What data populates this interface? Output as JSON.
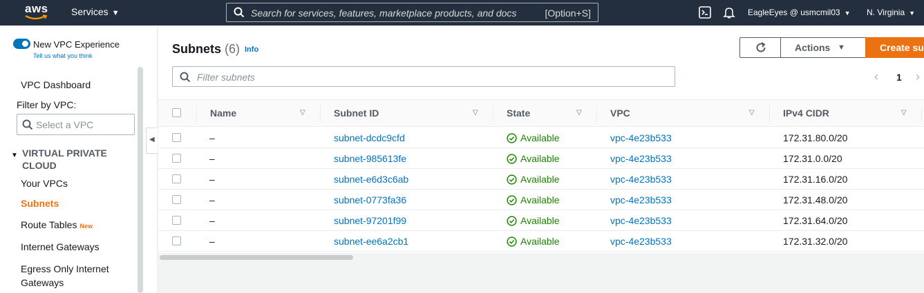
{
  "topbar": {
    "logo_text": "aws",
    "services_label": "Services",
    "search_placeholder": "Search for services, features, marketplace products, and docs",
    "search_shortcut": "[Option+S]",
    "account_label": "EagleEyes @ usmcmil03",
    "region_label": "N. Virginia"
  },
  "sidebar": {
    "toggle_label": "New VPC Experience",
    "tell_us_link": "Tell us what you think",
    "dashboard_label": "VPC Dashboard",
    "filter_label": "Filter by VPC:",
    "filter_placeholder": "Select a VPC",
    "section_heading": "VIRTUAL PRIVATE CLOUD",
    "items": [
      {
        "label": "Your VPCs"
      },
      {
        "label": "Subnets"
      },
      {
        "label": "Route Tables",
        "badge": "New"
      },
      {
        "label": "Internet Gateways"
      },
      {
        "label": "Egress Only Internet Gateways"
      }
    ]
  },
  "main": {
    "title": "Subnets",
    "count": "(6)",
    "info_link": "Info",
    "actions_label": "Actions",
    "create_label": "Create subnet",
    "filter_placeholder": "Filter subnets",
    "page_number": "1",
    "columns": [
      "Name",
      "Subnet ID",
      "State",
      "VPC",
      "IPv4 CIDR"
    ],
    "rows": [
      {
        "name": "–",
        "subnet_id": "subnet-dcdc9cfd",
        "state": "Available",
        "vpc": "vpc-4e23b533",
        "cidr": "172.31.80.0/20"
      },
      {
        "name": "–",
        "subnet_id": "subnet-985613fe",
        "state": "Available",
        "vpc": "vpc-4e23b533",
        "cidr": "172.31.0.0/20"
      },
      {
        "name": "–",
        "subnet_id": "subnet-e6d3c6ab",
        "state": "Available",
        "vpc": "vpc-4e23b533",
        "cidr": "172.31.16.0/20"
      },
      {
        "name": "–",
        "subnet_id": "subnet-0773fa36",
        "state": "Available",
        "vpc": "vpc-4e23b533",
        "cidr": "172.31.48.0/20"
      },
      {
        "name": "–",
        "subnet_id": "subnet-97201f99",
        "state": "Available",
        "vpc": "vpc-4e23b533",
        "cidr": "172.31.64.0/20"
      },
      {
        "name": "–",
        "subnet_id": "subnet-ee6a2cb1",
        "state": "Available",
        "vpc": "vpc-4e23b533",
        "cidr": "172.31.32.0/20"
      }
    ]
  },
  "colors": {
    "topbar_bg": "#232f3e",
    "accent_orange": "#ec7211",
    "link_blue": "#0073bb",
    "available_green": "#1d8102"
  }
}
